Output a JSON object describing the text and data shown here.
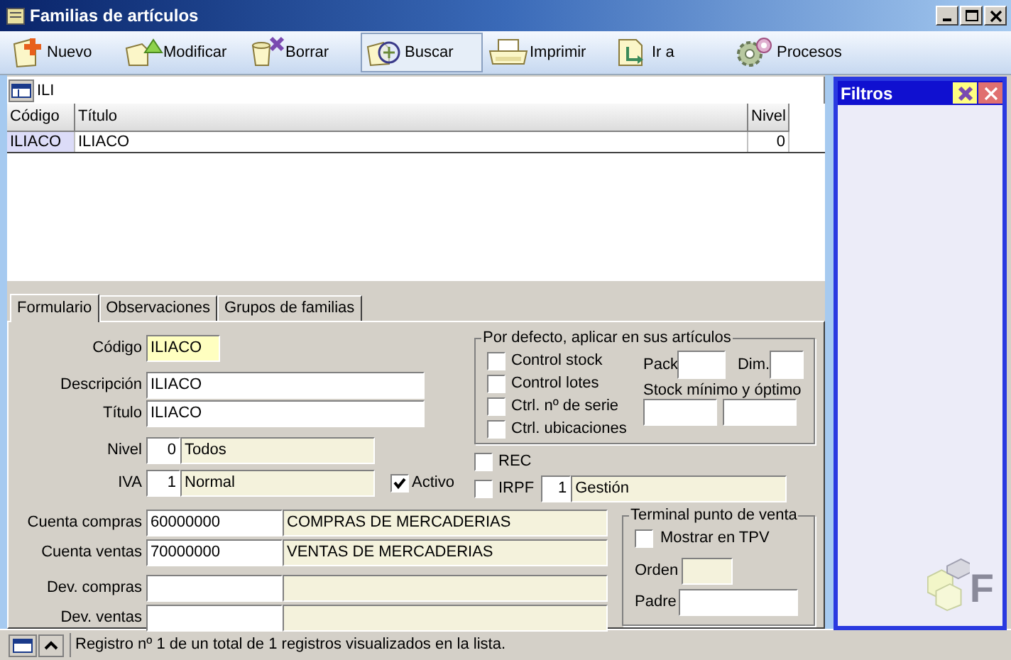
{
  "window": {
    "title": "Familias de artículos"
  },
  "toolbar": [
    {
      "label": "Nuevo",
      "kind": "new",
      "selected": false
    },
    {
      "label": "Modificar",
      "kind": "edit",
      "selected": false
    },
    {
      "label": "Borrar",
      "kind": "delete",
      "selected": false
    },
    {
      "label": "Buscar",
      "kind": "search",
      "selected": true
    },
    {
      "label": "Imprimir",
      "kind": "print",
      "selected": false
    },
    {
      "label": "Ir a",
      "kind": "goto",
      "selected": false
    },
    {
      "label": "Procesos",
      "kind": "process",
      "selected": false
    }
  ],
  "search": {
    "value": "ILI"
  },
  "table": {
    "columns": [
      "Código",
      "Título",
      "Nivel"
    ],
    "rows": [
      {
        "cells": [
          "ILIACO",
          "ILIACO",
          "0"
        ],
        "selected": true
      }
    ]
  },
  "filters_panel": {
    "title": "Filtros"
  },
  "logo": {
    "letter": "F"
  },
  "tabs": [
    {
      "label": "Formulario",
      "selected": true
    },
    {
      "label": "Observaciones",
      "selected": false
    },
    {
      "label": "Grupos de familias",
      "selected": false
    }
  ],
  "form": {
    "codigo": {
      "label": "Código",
      "value": "ILIACO"
    },
    "descripcion": {
      "label": "Descripción",
      "value": "ILIACO"
    },
    "titulo": {
      "label": "Título",
      "value": "ILIACO"
    },
    "nivel": {
      "label": "Nivel",
      "code": "0",
      "name": "Todos"
    },
    "iva": {
      "label": "IVA",
      "code": "1",
      "name": "Normal"
    },
    "activo": {
      "label": "Activo",
      "checked": true
    },
    "rec": {
      "label": "REC",
      "checked": false
    },
    "irpf": {
      "label": "IRPF",
      "checked": false,
      "code": "1",
      "name": "Gestión"
    },
    "accounts": [
      {
        "label": "Cuenta compras",
        "code": "60000000",
        "name": "COMPRAS DE MERCADERIAS"
      },
      {
        "label": "Cuenta ventas",
        "code": "70000000",
        "name": "VENTAS DE MERCADERIAS"
      },
      {
        "label": "Dev. compras"
      },
      {
        "label": "Dev. ventas"
      }
    ],
    "defaults": {
      "title": "Por defecto, aplicar en sus artículos",
      "options": [
        {
          "label": "Control stock",
          "checked": false
        },
        {
          "label": "Control lotes",
          "checked": false
        },
        {
          "label": "Ctrl. nº de serie",
          "checked": false
        },
        {
          "label": "Ctrl. ubicaciones",
          "checked": false
        }
      ],
      "pack_label": "Pack",
      "dim_label": "Dim.",
      "stock_label": "Stock mínimo y óptimo"
    },
    "tpv": {
      "title": "Terminal punto de venta",
      "show": {
        "label": "Mostrar en TPV",
        "checked": false
      },
      "order_label": "Orden",
      "parent_label": "Padre"
    }
  },
  "status_bar": {
    "text": "Registro nº 1 de un total de 1 registros visualizados en la lista."
  }
}
